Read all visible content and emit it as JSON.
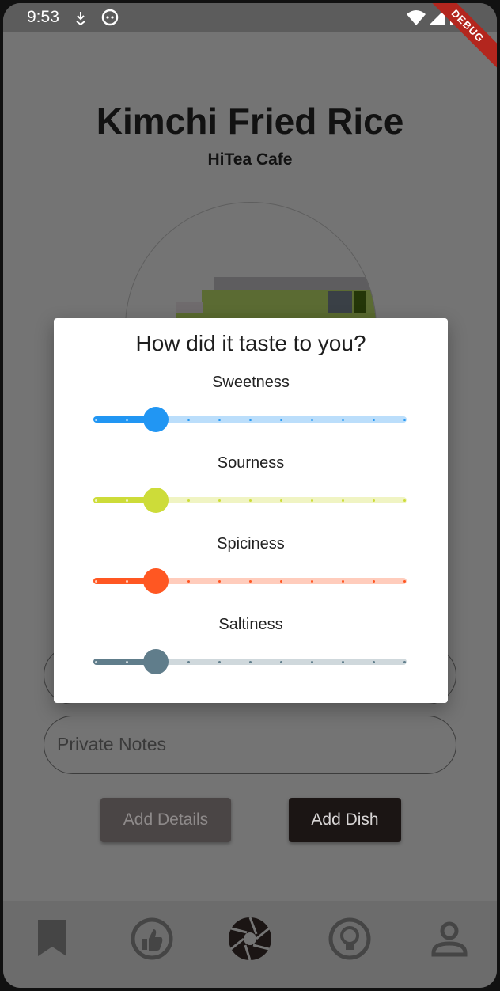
{
  "status_bar": {
    "time": "9:53",
    "icons": [
      "download-icon",
      "android-icon",
      "wifi-icon",
      "cell-signal-icon",
      "battery-icon"
    ],
    "debug_label": "DEBUG"
  },
  "dish": {
    "name": "Kimchi Fried Rice",
    "restaurant": "HiTea Cafe"
  },
  "form": {
    "private_notes_placeholder": "Private Notes"
  },
  "buttons": {
    "add_details": "Add Details",
    "add_dish": "Add Dish"
  },
  "bottom_nav": {
    "items": [
      "bookmark-icon",
      "thumbs-up-icon",
      "camera-shutter-icon",
      "lightbulb-icon",
      "person-icon"
    ]
  },
  "dialog": {
    "title": "How did it taste to you?",
    "sliders": [
      {
        "label": "Sweetness",
        "value": 2,
        "max": 10,
        "color": "#2196F3",
        "track_color": "#BBDEFB"
      },
      {
        "label": "Sourness",
        "value": 2,
        "max": 10,
        "color": "#CDDC39",
        "track_color": "#F0F4C3"
      },
      {
        "label": "Spiciness",
        "value": 2,
        "max": 10,
        "color": "#FF5722",
        "track_color": "#FFCCBC"
      },
      {
        "label": "Saltiness",
        "value": 2,
        "max": 10,
        "color": "#607D8B",
        "track_color": "#CFD8DC"
      }
    ]
  }
}
